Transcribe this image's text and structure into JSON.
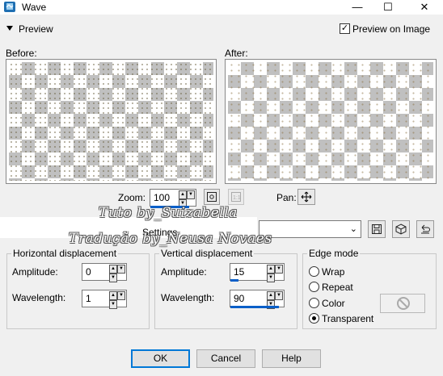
{
  "window": {
    "title": "Wave",
    "minimize": "—",
    "maximize": "☐",
    "close": "✕"
  },
  "preview": {
    "label": "Preview",
    "preview_on_image_label": "Preview on Image",
    "preview_on_image_checked": true
  },
  "panels": {
    "before_label": "Before:",
    "after_label": "After:"
  },
  "zoom": {
    "label": "Zoom:",
    "value": "100",
    "pan_label": "Pan:"
  },
  "settings": {
    "label": "Settings",
    "preset_value": ""
  },
  "horizontal": {
    "title": "Horizontal displacement",
    "amplitude_label": "Amplitude:",
    "amplitude": "0",
    "wavelength_label": "Wavelength:",
    "wavelength": "1"
  },
  "vertical": {
    "title": "Vertical displacement",
    "amplitude_label": "Amplitude:",
    "amplitude": "15",
    "wavelength_label": "Wavelength:",
    "wavelength": "90"
  },
  "edge_mode": {
    "title": "Edge mode",
    "options": [
      "Wrap",
      "Repeat",
      "Color",
      "Transparent"
    ],
    "selected": "Transparent"
  },
  "buttons": {
    "ok": "OK",
    "cancel": "Cancel",
    "help": "Help"
  },
  "watermark": {
    "line1": "Tuto by_Suizabella",
    "line2": "Tradução by_Neusa Novaes"
  },
  "colors": {
    "accent": "#0078d7",
    "underline": "#0a5fc8"
  }
}
